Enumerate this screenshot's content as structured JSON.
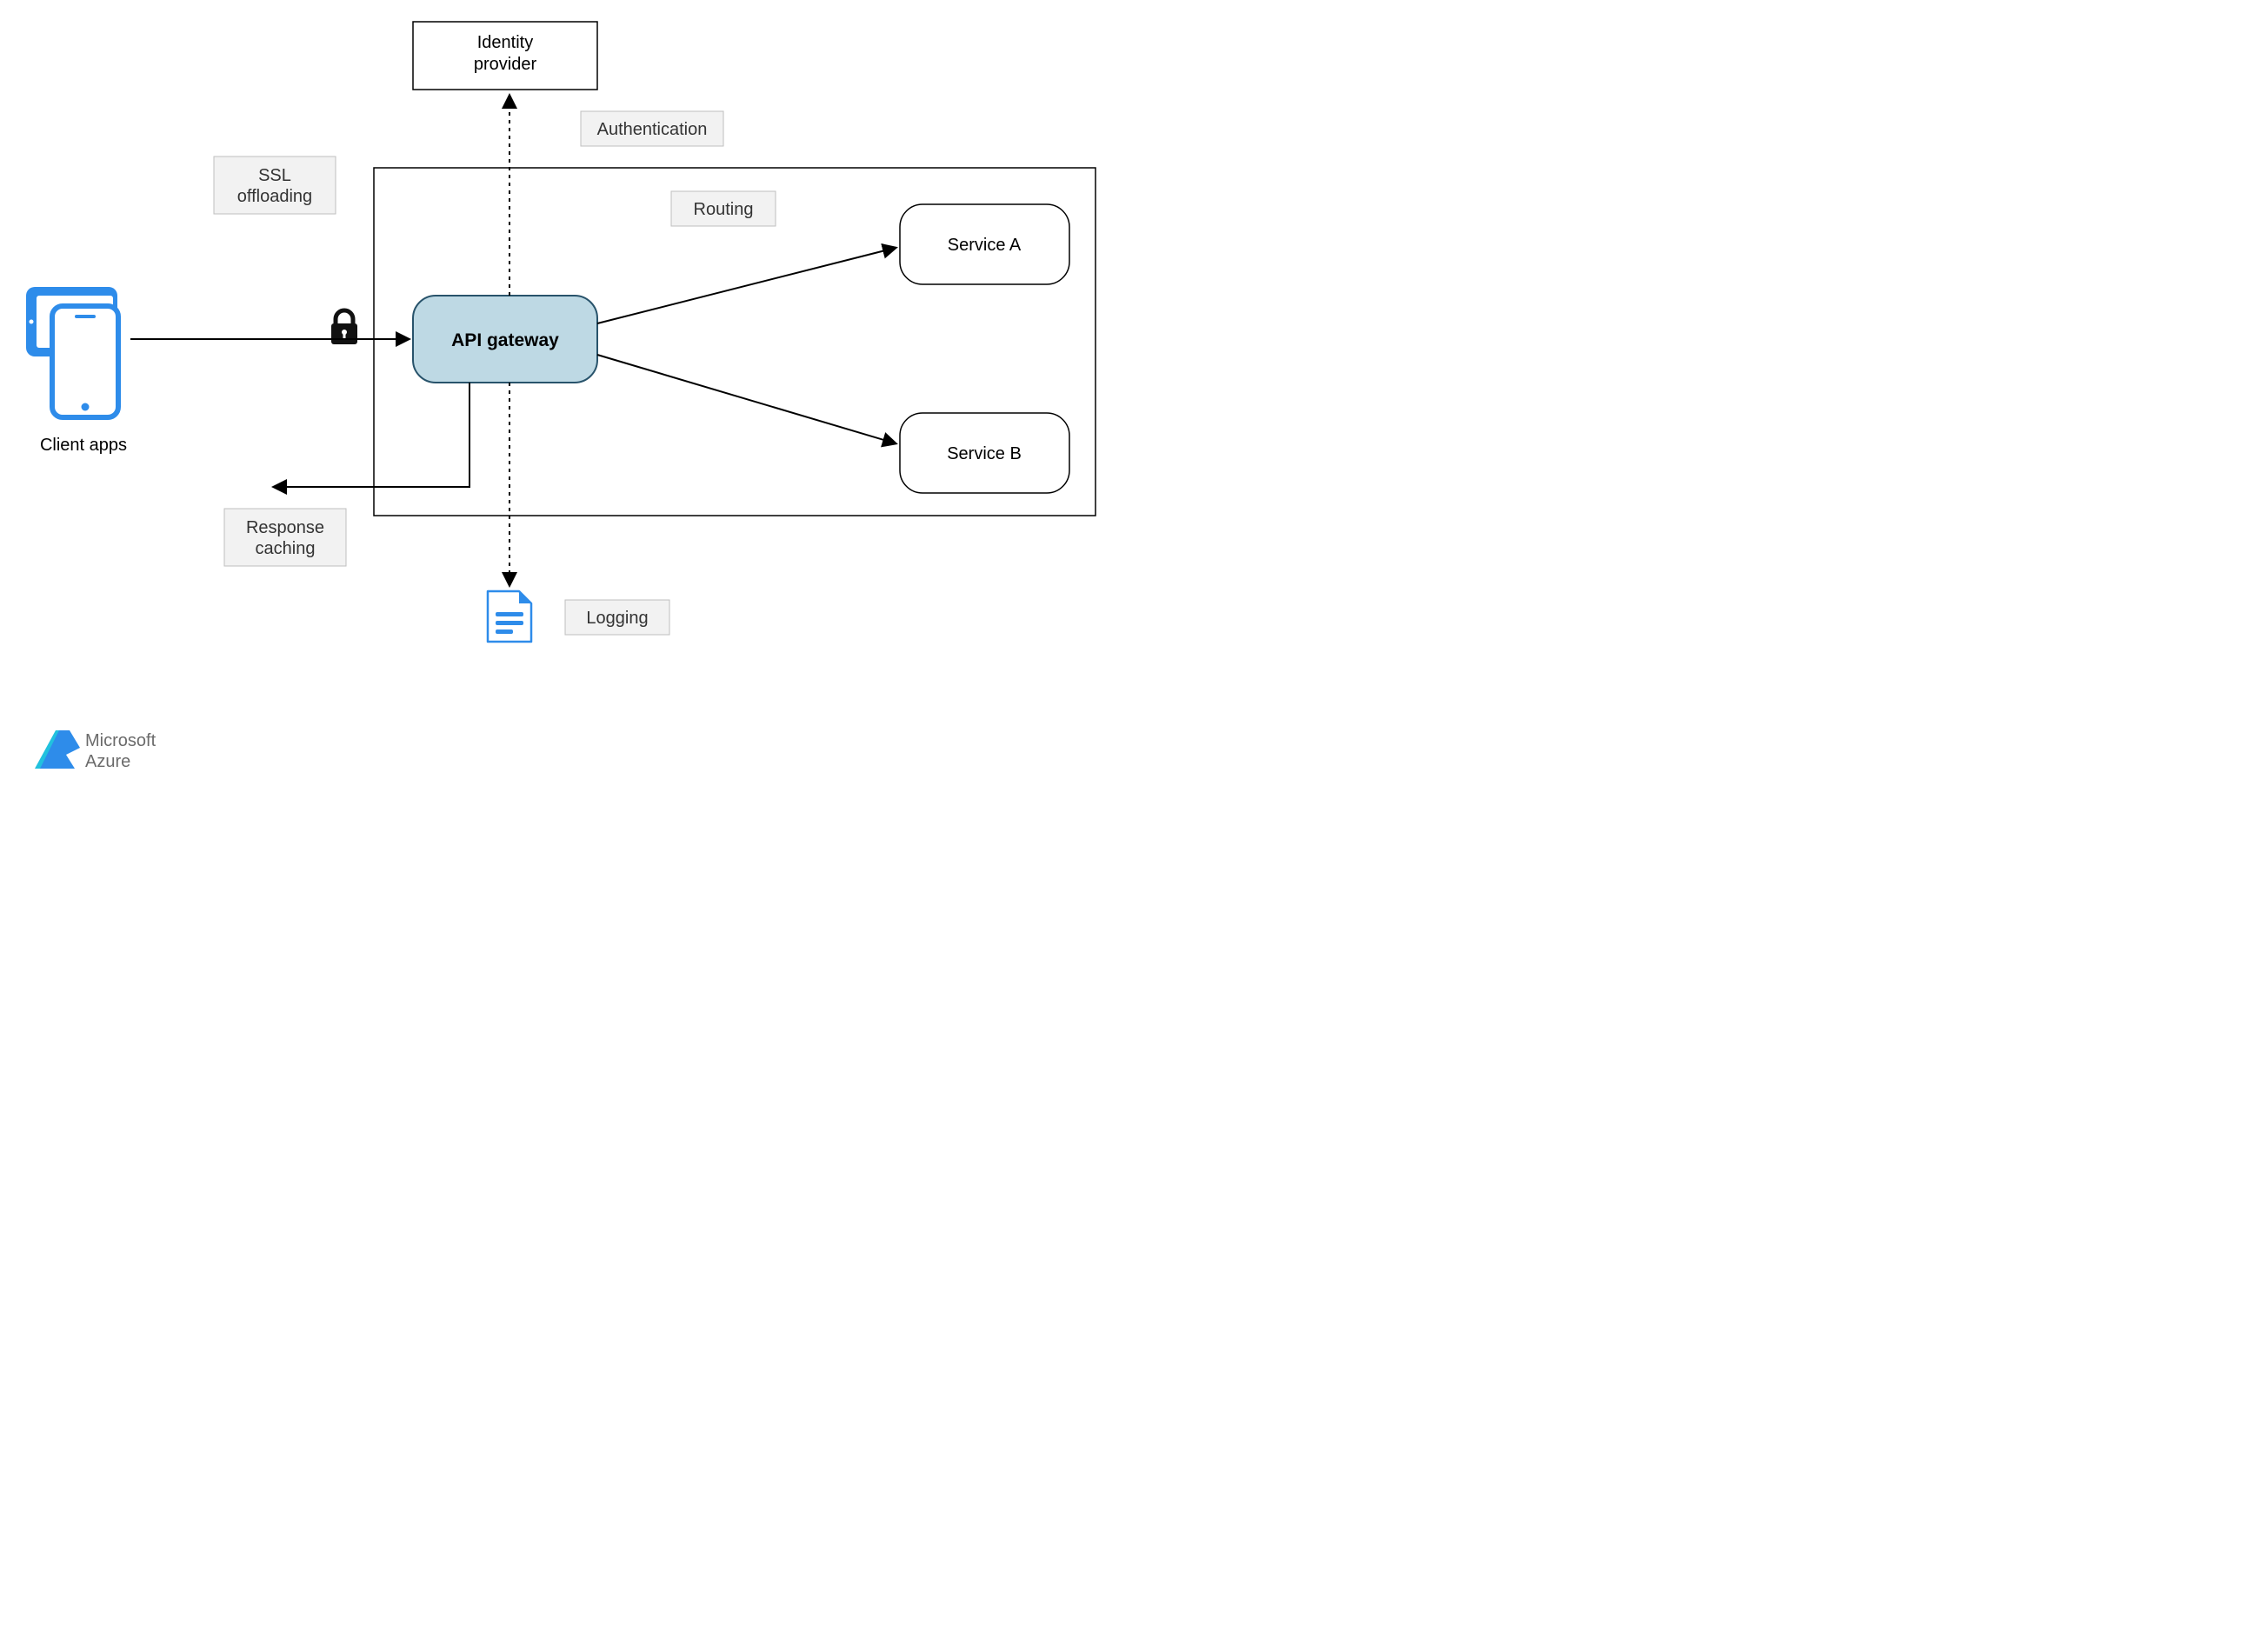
{
  "nodes": {
    "identityProvider": {
      "line1": "Identity",
      "line2": "provider"
    },
    "apiGateway": "API gateway",
    "serviceA": "Service A",
    "serviceB": "Service B",
    "clientApps": "Client apps"
  },
  "tags": {
    "sslOffloading": {
      "line1": "SSL",
      "line2": "offloading"
    },
    "authentication": "Authentication",
    "routing": "Routing",
    "responseCaching": {
      "line1": "Response",
      "line2": "caching"
    },
    "logging": "Logging"
  },
  "branding": {
    "line1": "Microsoft",
    "line2": "Azure"
  },
  "colors": {
    "apiGatewayFill": "#bed9e4",
    "apiGatewayStroke": "#28536b",
    "azurePrimary": "#2e8cea",
    "azureAccent": "#21c1de",
    "documentOutline": "#2e8cea"
  }
}
